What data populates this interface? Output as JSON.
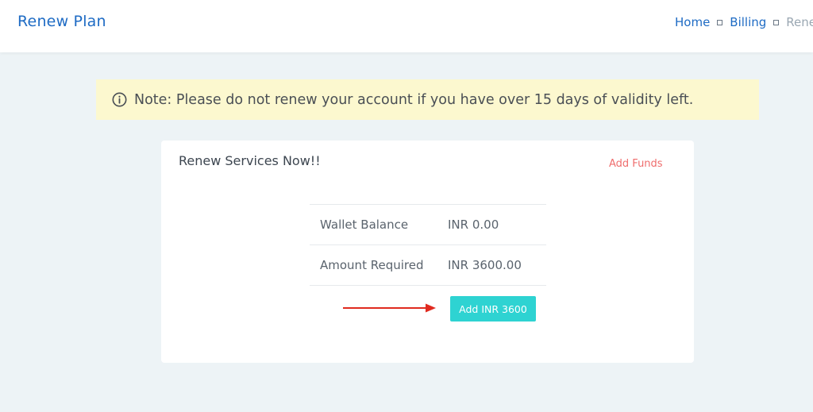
{
  "header": {
    "title": "Renew Plan",
    "breadcrumb": {
      "home": "Home",
      "billing": "Billing",
      "current": "Rene"
    }
  },
  "note": {
    "icon": "info-circle-icon",
    "text": "Note: Please do not renew your account if you have over 15 days of validity left."
  },
  "card": {
    "title": "Renew Services Now!!",
    "add_funds_label": "Add Funds",
    "rows": [
      {
        "label": "Wallet Balance",
        "value": "INR 0.00"
      },
      {
        "label": "Amount Required",
        "value": "INR 3600.00"
      }
    ],
    "button_label": "Add INR 3600"
  },
  "colors": {
    "brand": "#1e6bc4",
    "note_bg": "#fcf8cf",
    "accent_button": "#2ed3d2",
    "add_funds": "#ef6d6d",
    "arrow": "#e02a1f"
  }
}
